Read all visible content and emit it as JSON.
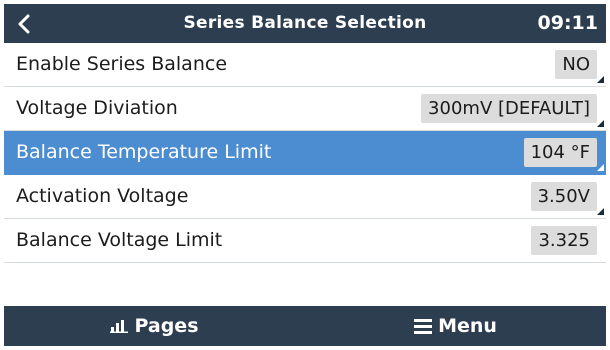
{
  "header": {
    "back_icon": "chevron-left-icon",
    "title": "Series Balance Selection",
    "time": "09:11"
  },
  "settings": [
    {
      "label": "Enable Series Balance",
      "value": "NO",
      "selected": false,
      "editable": true
    },
    {
      "label": "Voltage Diviation",
      "value": "300mV [DEFAULT]",
      "selected": false,
      "editable": true
    },
    {
      "label": "Balance Temperature Limit",
      "value": "104 °F",
      "selected": true,
      "editable": true
    },
    {
      "label": "Activation Voltage",
      "value": "3.50V",
      "selected": false,
      "editable": true
    },
    {
      "label": "Balance Voltage Limit",
      "value": "3.325",
      "selected": false,
      "editable": false
    }
  ],
  "footer": {
    "pages_label": "Pages",
    "pages_icon": "bar-chart-icon",
    "menu_label": "Menu",
    "menu_icon": "hamburger-menu-icon"
  },
  "colors": {
    "header_bg": "#2d3e50",
    "selected_row": "#4b8dd0",
    "value_box": "#dcdcdc"
  }
}
